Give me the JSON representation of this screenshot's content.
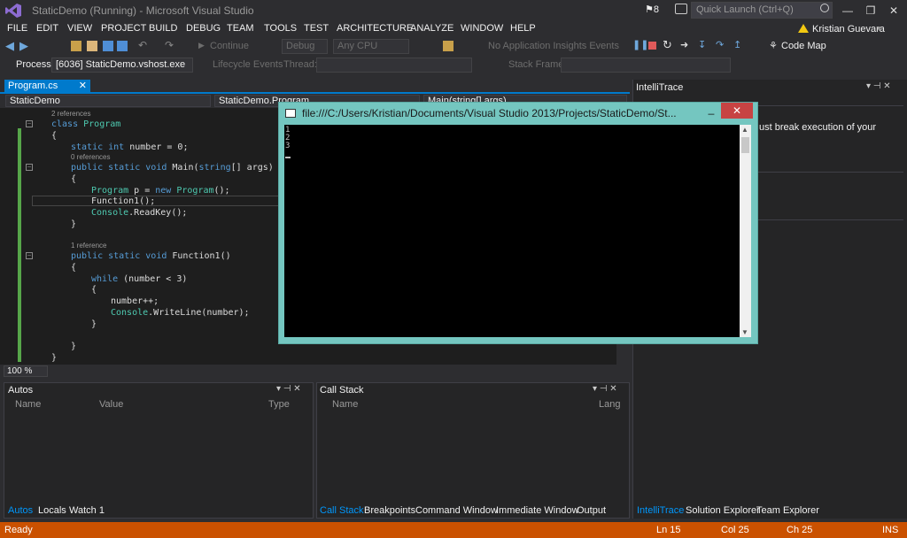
{
  "window": {
    "title": "StaticDemo (Running) - Microsoft Visual Studio",
    "notification_count": "8",
    "quick_launch_placeholder": "Quick Launch (Ctrl+Q)",
    "user_name": "Kristian Guevara"
  },
  "menu": [
    "FILE",
    "EDIT",
    "VIEW",
    "PROJECT",
    "BUILD",
    "DEBUG",
    "TEAM",
    "TOOLS",
    "TEST",
    "ARCHITECTURE",
    "ANALYZE",
    "WINDOW",
    "HELP"
  ],
  "toolbar": {
    "continue_label": "Continue",
    "config": "Debug",
    "platform": "Any CPU",
    "insights": "No Application Insights Events",
    "code_map": "Code Map"
  },
  "debug_location": {
    "process_label": "Process:",
    "process_value": "[6036] StaticDemo.vshost.exe",
    "lifecycle": "Lifecycle Events",
    "thread_label": "Thread:",
    "stack_frame_label": "Stack Frame:"
  },
  "tabs": {
    "active": "Program.cs"
  },
  "navbar": {
    "project": "StaticDemo",
    "type": "StaticDemo.Program",
    "member": "Main(string[] args)"
  },
  "code": {
    "ref_class": "2 references",
    "ref_number": "0 references",
    "ref_function": "1 reference",
    "lines": [
      "class Program",
      "{",
      "static int number = 0;",
      "public static void Main(string[] args)",
      "{",
      "Program p = new Program();",
      "Function1();",
      "Console.ReadKey();",
      "}",
      "public static void Function1()",
      "{",
      "while (number < 3)",
      "{",
      "number++;",
      "Console.WriteLine(number);",
      "}",
      "}",
      "}"
    ]
  },
  "zoom": "100 %",
  "autos": {
    "title": "Autos",
    "col_name": "Name",
    "col_value": "Value",
    "col_type": "Type",
    "tabs": [
      "Autos",
      "Locals",
      "Watch 1"
    ]
  },
  "callstack": {
    "title": "Call Stack",
    "col_name": "Name",
    "col_lang": "Lang",
    "tabs": [
      "Call Stack",
      "Breakpoints",
      "Command Window",
      "Immediate Window",
      "Output"
    ]
  },
  "intellitrace": {
    "title": "IntelliTrace",
    "text": "ust break execution of your",
    "tabs": [
      "IntelliTrace",
      "Solution Explorer",
      "Team Explorer"
    ]
  },
  "console": {
    "title": "file:///C:/Users/Kristian/Documents/Visual Studio 2013/Projects/StaticDemo/St...",
    "lines": [
      "1",
      "2",
      "3"
    ]
  },
  "status": {
    "ready": "Ready",
    "ln": "Ln 15",
    "col": "Col 25",
    "ch": "Ch 25",
    "ins": "INS"
  },
  "colors": {
    "accent": "#007acc",
    "status_bar": "#ca5100",
    "console_frame": "#74c6c0"
  }
}
